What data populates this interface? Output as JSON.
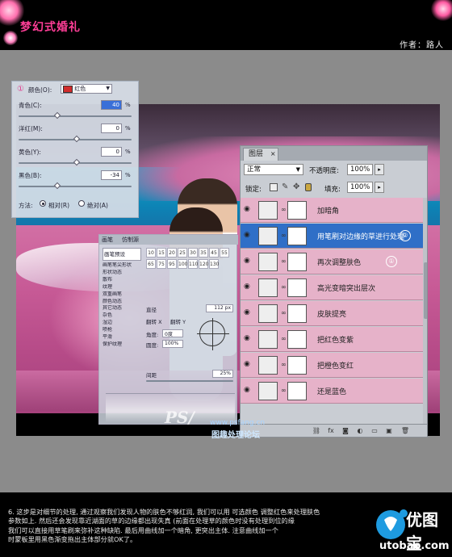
{
  "header": {
    "title": "梦幻式婚礼",
    "author": "作者：路人"
  },
  "selective_color": {
    "circle_marker": "①",
    "colors_label": "颜色(O):",
    "colors_value": "红色",
    "colors_swatch": "#d12c2c",
    "sliders": [
      {
        "label": "青色(C):",
        "value": "40",
        "level_pct": 40
      },
      {
        "label": "洋红(M):",
        "value": "0",
        "level_pct": 0
      },
      {
        "label": "黄色(Y):",
        "value": "0",
        "level_pct": 0
      },
      {
        "label": "黑色(B):",
        "value": "-34",
        "level_pct": -34
      }
    ],
    "pct": "%",
    "method_label": "方法:",
    "method_relative": "相对(R)",
    "method_absolute": "绝对(A)"
  },
  "brush_panel": {
    "tabs": [
      "画笔",
      "仿制源"
    ],
    "sidebar_title": "画笔预设",
    "sidebar_items": [
      "画笔笔尖形状",
      "形状动态",
      "散布",
      "纹理",
      "双重画笔",
      "颜色动态",
      "其它动态",
      "杂色",
      "湿边",
      "喷枪",
      "平滑",
      "保护纹理"
    ],
    "size_label": "直径",
    "size_value": "112 px",
    "flip_x": "翻转 X",
    "flip_y": "翻转 Y",
    "angle_label": "角度:",
    "angle_value": "0度",
    "roundness_label": "圆度:",
    "roundness_value": "100%",
    "spacing_label": "间距",
    "spacing_value": "25%",
    "brush_sizes": [
      "10",
      "15",
      "20",
      "25",
      "30",
      "35",
      "45",
      "55",
      "65",
      "75",
      "95",
      "100",
      "110",
      "120",
      "130"
    ]
  },
  "layers_panel": {
    "tab_label": "图层",
    "blend_mode": "正常",
    "opacity_label": "不透明度:",
    "opacity_value": "100%",
    "lock_label": "锁定:",
    "fill_label": "填充:",
    "fill_value": "100%",
    "layers": [
      {
        "name": "加暗角",
        "selected": false,
        "badge": ""
      },
      {
        "name": "用笔刷对边缘的草进行处理",
        "selected": true,
        "badge": "②"
      },
      {
        "name": "再次调整肤色",
        "selected": false,
        "badge": "①"
      },
      {
        "name": "高光变暗突出层次",
        "selected": false,
        "badge": ""
      },
      {
        "name": "皮肤提亮",
        "selected": false,
        "badge": ""
      },
      {
        "name": "把红色变紫",
        "selected": false,
        "badge": ""
      },
      {
        "name": "把橙色变红",
        "selected": false,
        "badge": ""
      },
      {
        "name": "还是蓝色",
        "selected": false,
        "badge": ""
      }
    ]
  },
  "watermark": {
    "text": "图趣处理论坛",
    "url": "www.psfang.cn"
  },
  "paragraph": [
    "6. 这步是对细节的处理, 通过观察我们发现人物的肤色不够红润, 我们可以用 可选颜色 调整红色来处理肤色",
    "参数如上. 然后还会发现靠近湖面的草的边缘都出现失真 (前面在处理草的颜色时没有处理到位的缘",
    "我们可以直接用草笔刷来弥补这种缺陷. 最后用曲线加一个暗角, 更突出主体. 注意曲线加一个",
    "时蒙板里用黑色渐变拖出主体部分就OK了。"
  ],
  "logo": {
    "name": "优图宝",
    "url": "utobao.com"
  },
  "colors": {
    "accent_pink": "#ff3e97",
    "layer_pink": "#e6b2c9",
    "layer_selected": "#2f6fc7"
  }
}
